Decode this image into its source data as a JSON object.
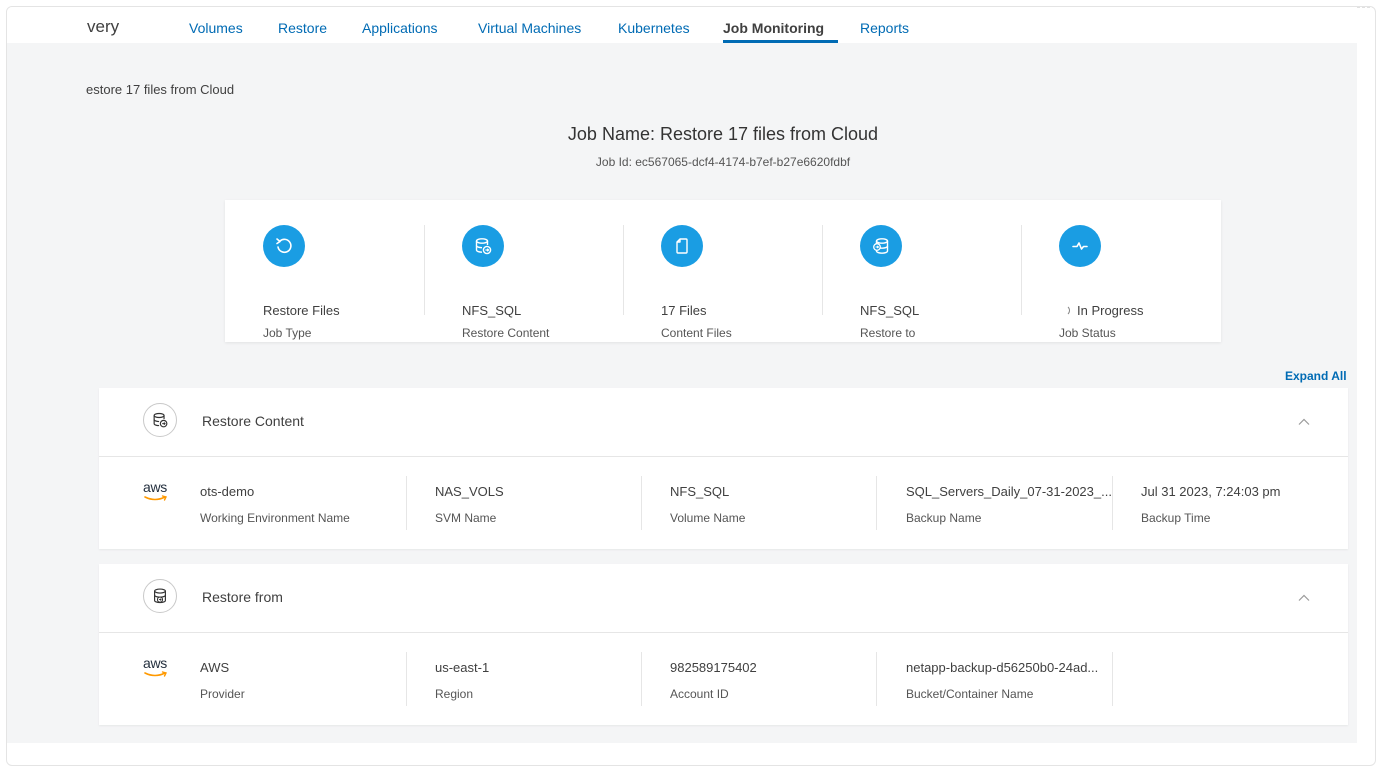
{
  "nav": {
    "brand": "very",
    "tabs": [
      {
        "label": "Volumes"
      },
      {
        "label": "Restore"
      },
      {
        "label": "Applications"
      },
      {
        "label": "Virtual Machines"
      },
      {
        "label": "Kubernetes"
      },
      {
        "label": "Job Monitoring"
      },
      {
        "label": "Reports"
      }
    ],
    "active_tab": "Job Monitoring"
  },
  "breadcrumb": "estore 17 files from Cloud",
  "job": {
    "title": "Job Name: Restore 17 files from Cloud",
    "id": "Job Id: ec567065-dcf4-4174-b7ef-b27e6620fdbf"
  },
  "summary": [
    {
      "value": "Restore Files",
      "label": "Job Type",
      "icon": "restore-icon"
    },
    {
      "value": "NFS_SQL",
      "label": "Restore Content",
      "icon": "database-restore-icon"
    },
    {
      "value": "17 Files",
      "label": "Content Files",
      "icon": "file-icon"
    },
    {
      "value": "NFS_SQL",
      "label": "Restore to",
      "icon": "database-target-icon"
    },
    {
      "value": "In Progress",
      "label": "Job Status",
      "icon": "activity-icon"
    }
  ],
  "expand_all": "Expand All",
  "restore_content": {
    "title": "Restore Content",
    "provider_logo": "aws",
    "cells": [
      {
        "value": "ots-demo",
        "label": "Working Environment Name"
      },
      {
        "value": "NAS_VOLS",
        "label": "SVM Name"
      },
      {
        "value": "NFS_SQL",
        "label": "Volume Name"
      },
      {
        "value": "SQL_Servers_Daily_07-31-2023_...",
        "label": "Backup Name"
      },
      {
        "value": "Jul 31 2023, 7:24:03 pm",
        "label": "Backup Time"
      }
    ]
  },
  "restore_from": {
    "title": "Restore from",
    "provider_logo": "aws",
    "cells": [
      {
        "value": "AWS",
        "label": "Provider"
      },
      {
        "value": "us-east-1",
        "label": "Region"
      },
      {
        "value": "982589175402",
        "label": "Account ID"
      },
      {
        "value": "netapp-backup-d56250b0-24ad...",
        "label": "Bucket/Container Name"
      }
    ]
  },
  "colors": {
    "accent": "#1a9de3",
    "link": "#006bb4",
    "background": "#f4f5f6"
  }
}
